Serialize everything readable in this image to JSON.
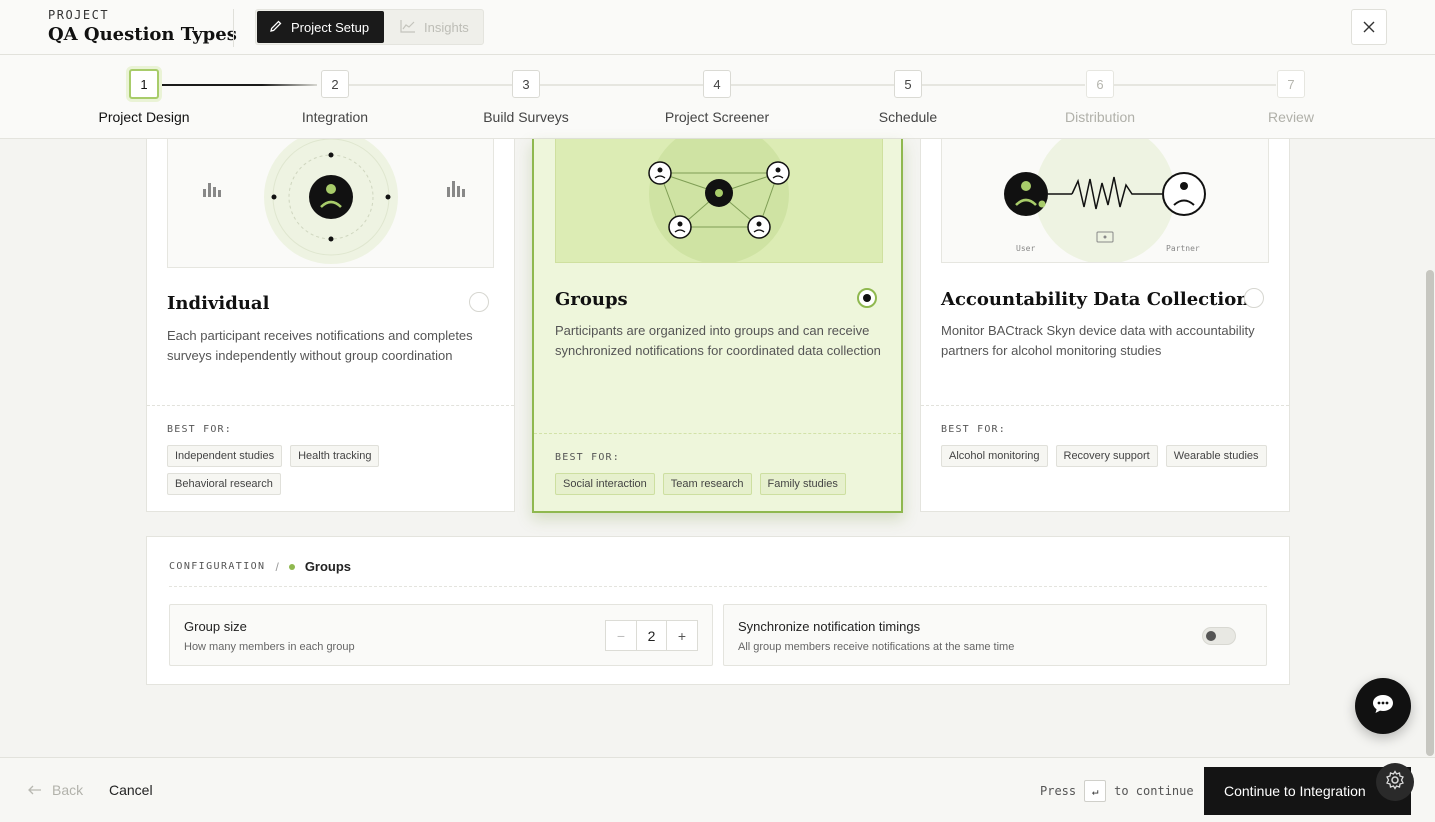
{
  "header": {
    "kicker": "PROJECT",
    "title": "QA Question Types",
    "tabs": [
      {
        "label": "Project Setup",
        "icon": "pencil-icon",
        "active": true
      },
      {
        "label": "Insights",
        "icon": "chart-line-icon",
        "active": false
      }
    ],
    "close_icon": "close-icon"
  },
  "steps": [
    {
      "num": "1",
      "label": "Project Design",
      "state": "active"
    },
    {
      "num": "2",
      "label": "Integration",
      "state": "upcoming"
    },
    {
      "num": "3",
      "label": "Build Surveys",
      "state": "upcoming"
    },
    {
      "num": "4",
      "label": "Project Screener",
      "state": "upcoming"
    },
    {
      "num": "5",
      "label": "Schedule",
      "state": "upcoming"
    },
    {
      "num": "6",
      "label": "Distribution",
      "state": "disabled"
    },
    {
      "num": "7",
      "label": "Review",
      "state": "disabled"
    }
  ],
  "cards": [
    {
      "title": "Individual",
      "selected": false,
      "description": "Each participant receives notifications and completes surveys independently without group coordination",
      "best_for_label": "BEST FOR:",
      "tags": [
        "Independent studies",
        "Health tracking",
        "Behavioral research"
      ]
    },
    {
      "title": "Groups",
      "selected": true,
      "description": "Participants are organized into groups and can receive synchronized notifications for coordinated data collection",
      "best_for_label": "BEST FOR:",
      "tags": [
        "Social interaction",
        "Team research",
        "Family studies"
      ]
    },
    {
      "title": "Accountability Data Collection",
      "selected": false,
      "description": "Monitor BACtrack Skyn device data with accountability partners for alcohol monitoring studies",
      "best_for_label": "BEST FOR:",
      "tags": [
        "Alcohol monitoring",
        "Recovery support",
        "Wearable studies"
      ],
      "illus_labels": {
        "left": "User",
        "right": "Partner"
      }
    }
  ],
  "config": {
    "kicker": "CONFIGURATION",
    "separator": "/",
    "name": "Groups",
    "group_size": {
      "title": "Group size",
      "subtitle": "How many members in each group",
      "value": "2",
      "minus": "−",
      "plus": "+"
    },
    "sync": {
      "title": "Synchronize notification timings",
      "subtitle": "All group members receive notifications at the same time",
      "enabled": false
    }
  },
  "footer": {
    "back_label": "Back",
    "cancel_label": "Cancel",
    "press_label": "Press",
    "key_symbol": "↵",
    "continue_hint": "to continue",
    "continue_label": "Continue to Integration"
  },
  "colors": {
    "accent": "#8fb84f",
    "accent_light": "#eef6db",
    "dark": "#141414"
  }
}
